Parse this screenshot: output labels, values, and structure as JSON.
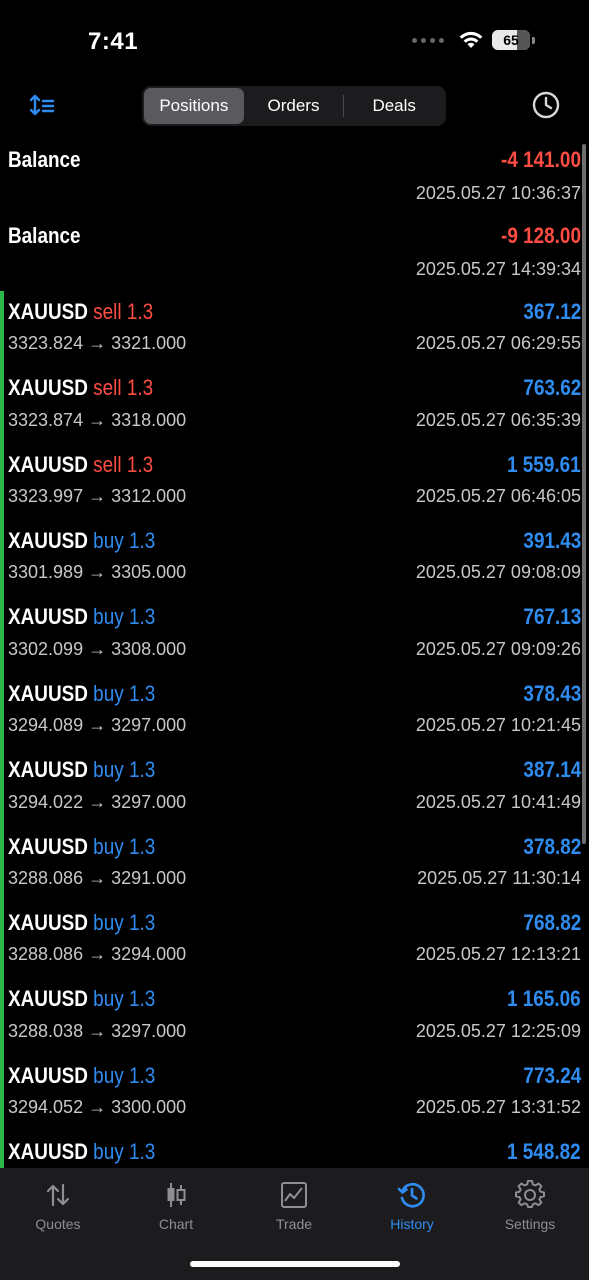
{
  "status": {
    "time": "7:41",
    "battery": "65"
  },
  "header": {
    "tabs": [
      {
        "label": "Positions",
        "active": true
      },
      {
        "label": "Orders",
        "active": false
      },
      {
        "label": "Deals",
        "active": false
      }
    ]
  },
  "balances": [
    {
      "label": "Balance",
      "amount": "-4 141.00",
      "time": "2025.05.27 10:36:37"
    },
    {
      "label": "Balance",
      "amount": "-9 128.00",
      "time": "2025.05.27 14:39:34"
    }
  ],
  "deals": [
    {
      "symbol": "XAUUSD",
      "side": "sell",
      "volume": "1.3",
      "prices": "3323.824 → 3321.000",
      "profit": "367.12",
      "time": "2025.05.27 06:29:55"
    },
    {
      "symbol": "XAUUSD",
      "side": "sell",
      "volume": "1.3",
      "prices": "3323.874 → 3318.000",
      "profit": "763.62",
      "time": "2025.05.27 06:35:39"
    },
    {
      "symbol": "XAUUSD",
      "side": "sell",
      "volume": "1.3",
      "prices": "3323.997 → 3312.000",
      "profit": "1 559.61",
      "time": "2025.05.27 06:46:05"
    },
    {
      "symbol": "XAUUSD",
      "side": "buy",
      "volume": "1.3",
      "prices": "3301.989 → 3305.000",
      "profit": "391.43",
      "time": "2025.05.27 09:08:09"
    },
    {
      "symbol": "XAUUSD",
      "side": "buy",
      "volume": "1.3",
      "prices": "3302.099 → 3308.000",
      "profit": "767.13",
      "time": "2025.05.27 09:09:26"
    },
    {
      "symbol": "XAUUSD",
      "side": "buy",
      "volume": "1.3",
      "prices": "3294.089 → 3297.000",
      "profit": "378.43",
      "time": "2025.05.27 10:21:45"
    },
    {
      "symbol": "XAUUSD",
      "side": "buy",
      "volume": "1.3",
      "prices": "3294.022 → 3297.000",
      "profit": "387.14",
      "time": "2025.05.27 10:41:49"
    },
    {
      "symbol": "XAUUSD",
      "side": "buy",
      "volume": "1.3",
      "prices": "3288.086 → 3291.000",
      "profit": "378.82",
      "time": "2025.05.27 11:30:14"
    },
    {
      "symbol": "XAUUSD",
      "side": "buy",
      "volume": "1.3",
      "prices": "3288.086 → 3294.000",
      "profit": "768.82",
      "time": "2025.05.27 12:13:21"
    },
    {
      "symbol": "XAUUSD",
      "side": "buy",
      "volume": "1.3",
      "prices": "3288.038 → 3297.000",
      "profit": "1 165.06",
      "time": "2025.05.27 12:25:09"
    },
    {
      "symbol": "XAUUSD",
      "side": "buy",
      "volume": "1.3",
      "prices": "3294.052 → 3300.000",
      "profit": "773.24",
      "time": "2025.05.27 13:31:52"
    },
    {
      "symbol": "XAUUSD",
      "side": "buy",
      "volume": "1.3",
      "prices": "",
      "profit": "1 548.82",
      "time": ""
    }
  ],
  "tabbar": [
    {
      "label": "Quotes",
      "icon": "arrows-updown-icon",
      "active": false
    },
    {
      "label": "Chart",
      "icon": "candlestick-icon",
      "active": false
    },
    {
      "label": "Trade",
      "icon": "trade-chart-icon",
      "active": false
    },
    {
      "label": "History",
      "icon": "history-icon",
      "active": true
    },
    {
      "label": "Settings",
      "icon": "gear-icon",
      "active": false
    }
  ],
  "colors": {
    "accent": "#2f8cf0",
    "negative": "#ff4d43",
    "deal_marker": "#2db84a"
  }
}
